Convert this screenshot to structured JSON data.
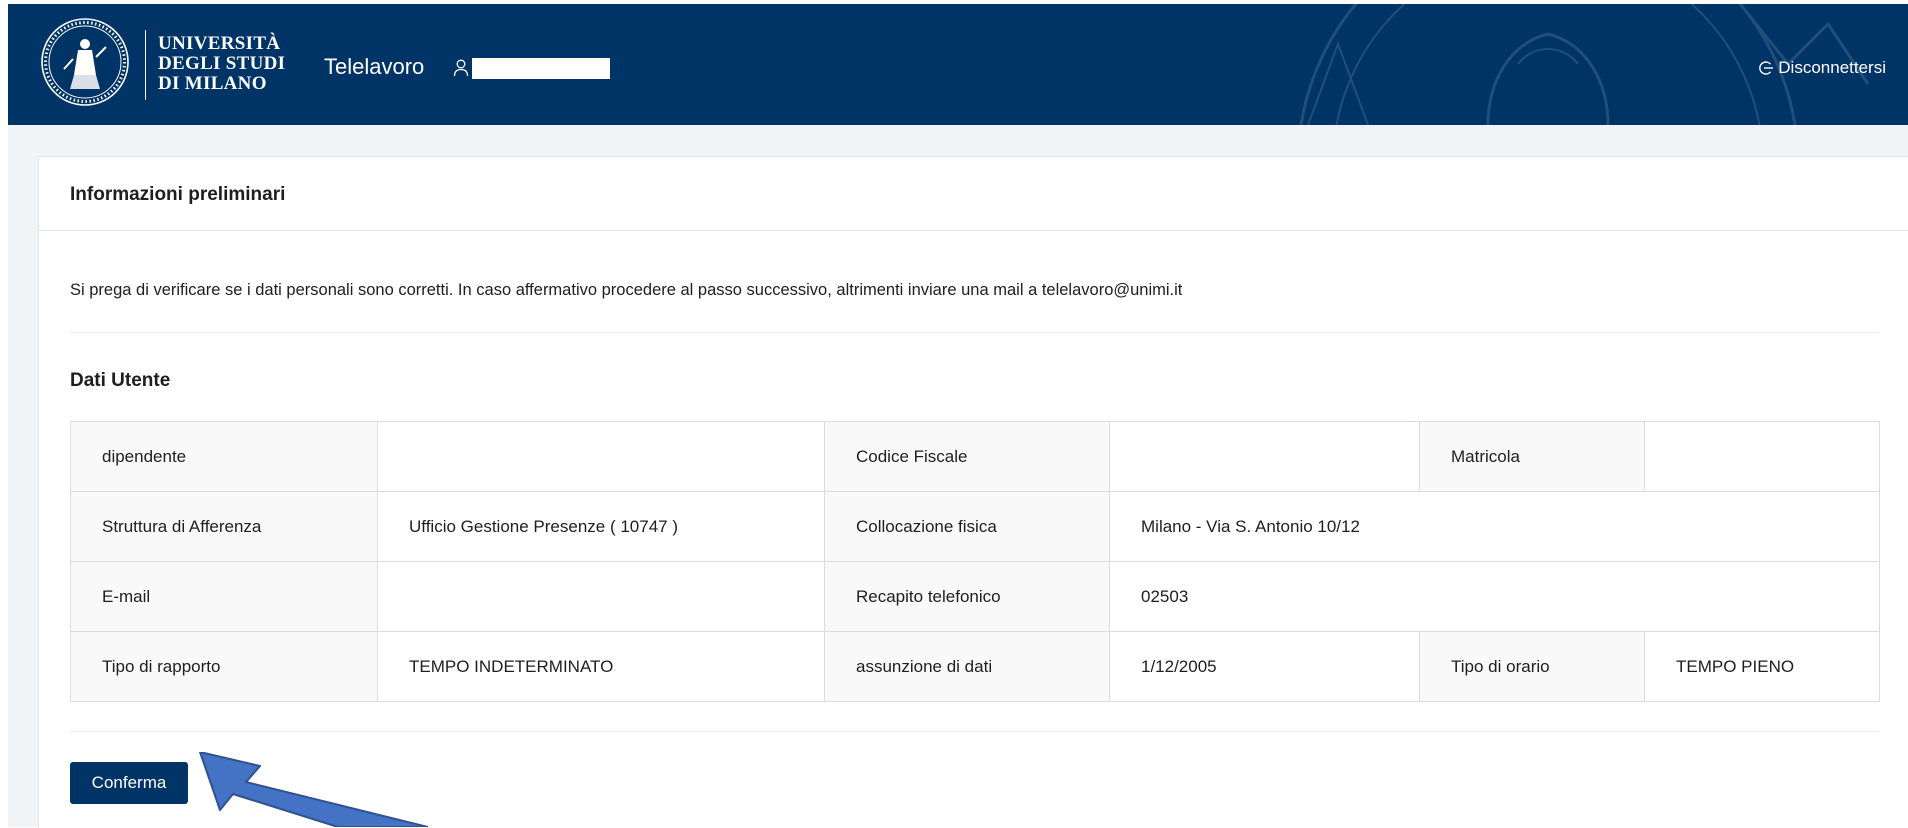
{
  "header": {
    "university_lines": [
      "UNIVERSITÀ",
      "DEGLI STUDI",
      "DI MILANO"
    ],
    "app_title": "Telelavoro",
    "logout_label": "Disconnettersi",
    "colors": {
      "brand": "#003366"
    },
    "icons": {
      "user": "user-icon",
      "logout": "logout-icon"
    }
  },
  "card": {
    "title": "Informazioni preliminari",
    "intro": "Si prega di verificare se i dati personali sono corretti. In caso affermativo procedere al passo successivo, altrimenti inviare una mail a telelavoro@unimi.it",
    "section_title": "Dati Utente",
    "confirm_label": "Conferma"
  },
  "user_table": {
    "dipendente_label": "dipendente",
    "dipendente_value": "",
    "codice_fiscale_label": "Codice Fiscale",
    "codice_fiscale_value": "",
    "matricola_label": "Matricola",
    "matricola_value": "",
    "struttura_label": "Struttura di Afferenza",
    "struttura_value": "Ufficio Gestione Presenze ( 10747 )",
    "collocazione_label": "Collocazione fisica",
    "collocazione_value": "Milano - Via S. Antonio 10/12",
    "email_label": "E-mail",
    "email_value": "",
    "recapito_label": "Recapito telefonico",
    "recapito_value": "02503",
    "tipo_rapporto_label": "Tipo di rapporto",
    "tipo_rapporto_value": "TEMPO INDETERMINATO",
    "assunzione_label": "assunzione di dati",
    "assunzione_value": "1/12/2005",
    "tipo_orario_label": "Tipo di orario",
    "tipo_orario_value": "TEMPO PIENO"
  }
}
